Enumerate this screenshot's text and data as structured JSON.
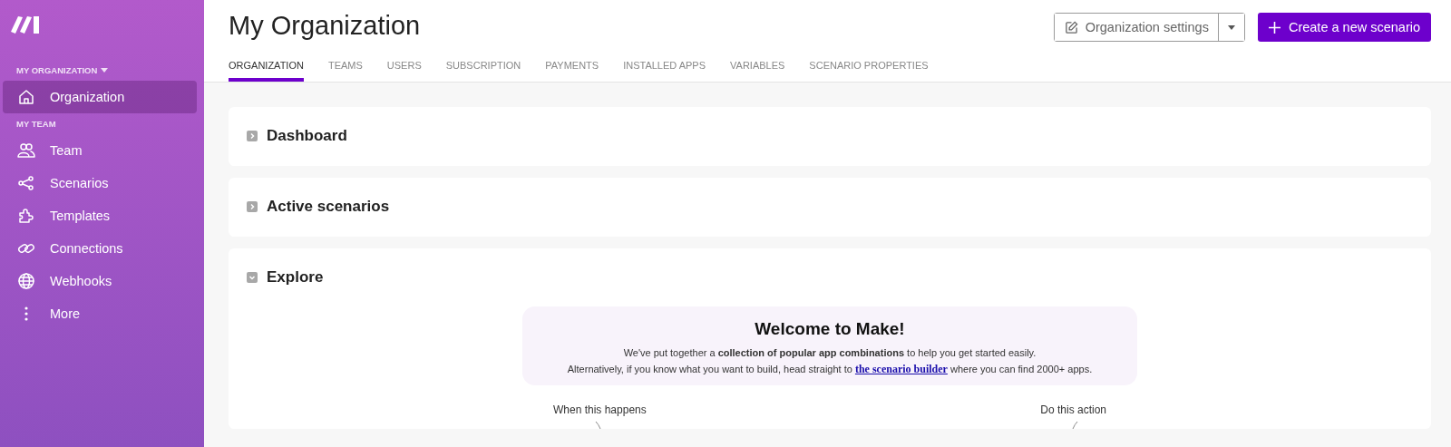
{
  "sidebar": {
    "org_label": "MY ORGANIZATION",
    "org_items": [
      {
        "label": "Organization",
        "selected": true
      }
    ],
    "team_label": "MY TEAM",
    "team_items": [
      {
        "label": "Team",
        "selected": false
      },
      {
        "label": "Scenarios",
        "selected": false
      },
      {
        "label": "Templates",
        "selected": false
      },
      {
        "label": "Connections",
        "selected": false
      },
      {
        "label": "Webhooks",
        "selected": false
      },
      {
        "label": "More",
        "selected": false
      }
    ]
  },
  "header": {
    "title": "My Organization",
    "settings_button": "Organization settings",
    "create_button": "Create a new scenario"
  },
  "tabs": [
    {
      "label": "ORGANIZATION",
      "selected": true
    },
    {
      "label": "TEAMS",
      "selected": false
    },
    {
      "label": "USERS",
      "selected": false
    },
    {
      "label": "SUBSCRIPTION",
      "selected": false
    },
    {
      "label": "PAYMENTS",
      "selected": false
    },
    {
      "label": "INSTALLED APPS",
      "selected": false
    },
    {
      "label": "VARIABLES",
      "selected": false
    },
    {
      "label": "SCENARIO PROPERTIES",
      "selected": false
    }
  ],
  "sections": [
    {
      "title": "Dashboard",
      "expanded": false
    },
    {
      "title": "Active scenarios",
      "expanded": false
    },
    {
      "title": "Explore",
      "expanded": true
    }
  ],
  "explore": {
    "welcome_title": "Welcome to Make!",
    "line_1": "We've put together a **collection of popular app combinations** to help you get started easily.",
    "line_2_before": "Alternatively, if you know what you want to build, head straight to",
    "line_2_link": "the scenario builder",
    "line_2_after": "where you can find 2000+ apps.",
    "trigger_label": "When this happens",
    "action_label": "Do this action"
  }
}
